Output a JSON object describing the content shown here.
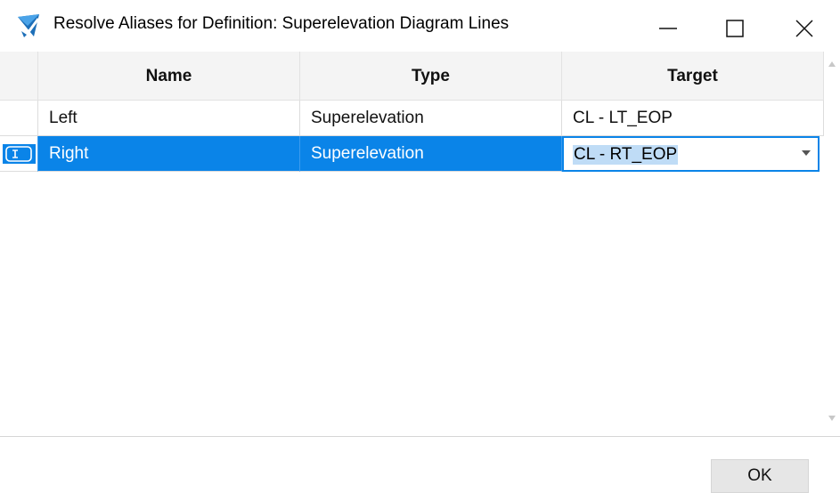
{
  "window": {
    "title": "Resolve Aliases for Definition: Superelevation Diagram Lines",
    "icon": "app-icon",
    "controls": {
      "minimize": "minimize-icon",
      "maximize": "maximize-icon",
      "close": "close-icon"
    }
  },
  "grid": {
    "columns": [
      "Name",
      "Type",
      "Target"
    ],
    "rows": [
      {
        "name": "Left",
        "type": "Superelevation",
        "target": "CL - LT_EOP",
        "selected": false
      },
      {
        "name": "Right",
        "type": "Superelevation",
        "target": "CL - RT_EOP",
        "selected": true
      }
    ]
  },
  "footer": {
    "ok_label": "OK"
  },
  "colors": {
    "selection": "#0a84e8",
    "text_highlight": "#bfdcf6",
    "header_bg": "#f4f4f4"
  }
}
